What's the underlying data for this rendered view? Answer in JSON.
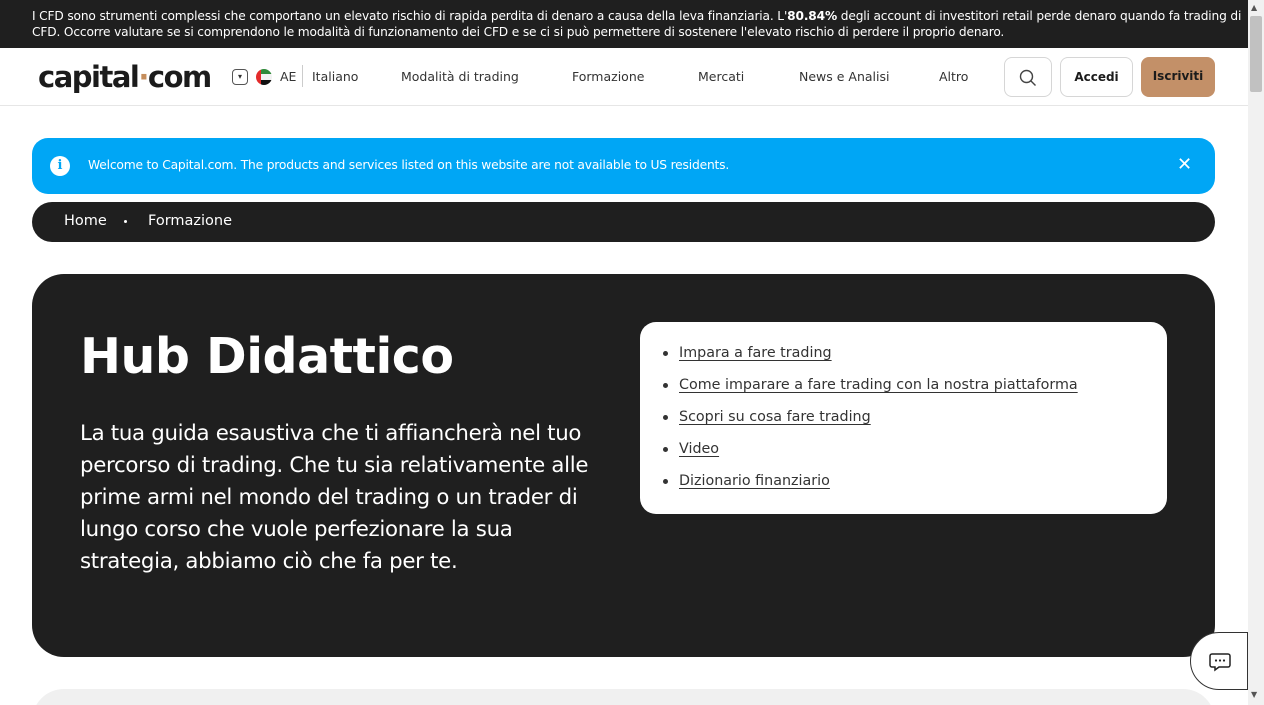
{
  "risk_banner": {
    "text_before": "I CFD sono strumenti complessi che comportano un elevato rischio di rapida perdita di denaro a causa della leva finanziaria. L'",
    "percentage": "80.84%",
    "text_after": " degli account di investitori retail perde denaro quando fa trading di CFD. Occorre valutare se si comprendono le modalità di funzionamento dei CFD e se ci si può permettere di sostenere l'elevato rischio di perdere il proprio denaro."
  },
  "header": {
    "logo_left": "capital",
    "logo_dot": "·",
    "logo_right": "com",
    "region": "AE",
    "language": "Italiano",
    "nav": [
      "Modalità di trading",
      "Formazione",
      "Mercati",
      "News e Analisi",
      "Altro"
    ],
    "login_label": "Accedi",
    "signup_label": "Iscriviti"
  },
  "notice": {
    "message": "Welcome to Capital.com. The products and services listed on this website are not available to US residents.",
    "close_symbol": "✕",
    "info_symbol": "i"
  },
  "breadcrumb": [
    "Home",
    "Formazione"
  ],
  "hero": {
    "title": "Hub Didattico",
    "description": "La tua guida esaustiva che ti affiancherà nel tuo percorso di trading. Che tu sia relativamente alle prime armi nel mondo del trading o un trader di lungo corso che vuole perfezionare la sua strategia, abbiamo ciò che fa per te.",
    "links": [
      "Impara a fare trading",
      "Come imparare a fare trading con la nostra piattaforma",
      "Scopri su cosa fare trading",
      "Video",
      "Dizionario finanziario"
    ]
  },
  "colors": {
    "accent": "#c39068",
    "notice_blue": "#00a6f5",
    "dark": "#1f1f1f"
  },
  "icons": [
    "chevron-down-icon",
    "uae-flag-icon",
    "search-icon",
    "info-icon",
    "close-icon",
    "chat-icon"
  ]
}
